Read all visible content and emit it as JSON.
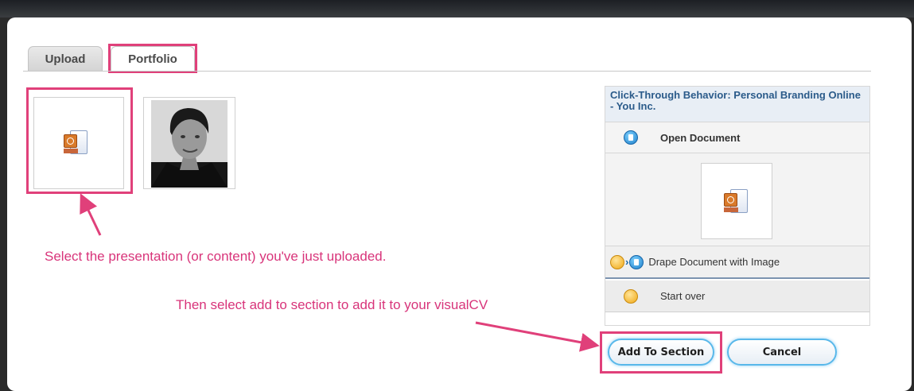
{
  "tabs": [
    {
      "label": "Upload",
      "active": false
    },
    {
      "label": "Portfolio",
      "active": true
    }
  ],
  "thumbnails": [
    {
      "type": "ppt-document",
      "icon": "ppt-file-icon",
      "selected": true
    },
    {
      "type": "photo",
      "icon": "profile-photo",
      "selected": false
    }
  ],
  "annotations": {
    "select_hint": "Select the presentation (or content) you've just uploaded.",
    "add_hint": "Then select add to section to add it to your visualCV"
  },
  "panel": {
    "title": "Click-Through Behavior: Personal Branding Online - You Inc.",
    "open_document": "Open Document",
    "drape_document": "Drape Document with Image",
    "start_over": "Start over"
  },
  "buttons": {
    "add_to_section": "Add To Section",
    "cancel": "Cancel"
  },
  "colors": {
    "annotation": "#d8347a",
    "panel_title": "#2b5b8a",
    "button_glow": "#59b8ea"
  }
}
